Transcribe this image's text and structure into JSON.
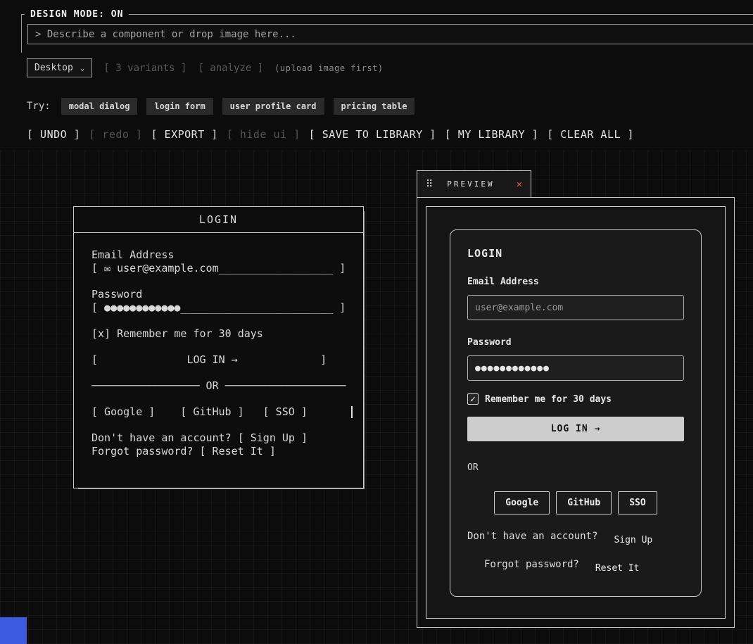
{
  "header": {
    "legend": "DESIGN MODE: ON",
    "prompt_placeholder": "> Describe a component or drop image here...",
    "device_select": "Desktop",
    "variants_button": "[ 3 variants ]",
    "analyze_button": "[ analyze ]",
    "upload_hint": "(upload image first)",
    "try_label": "Try:",
    "try_items": [
      "modal dialog",
      "login form",
      "user profile card",
      "pricing table"
    ],
    "toolbar": [
      {
        "label": "[ UNDO ]",
        "enabled": true
      },
      {
        "label": "[ redo ]",
        "enabled": false
      },
      {
        "label": "[ EXPORT ]",
        "enabled": true
      },
      {
        "label": "[ hide ui ]",
        "enabled": false
      },
      {
        "label": "[ SAVE TO LIBRARY ]",
        "enabled": true
      },
      {
        "label": "[ MY LIBRARY ]",
        "enabled": true
      },
      {
        "label": "[ CLEAR ALL ]",
        "enabled": true
      }
    ]
  },
  "ascii_panel": {
    "title": "LOGIN",
    "email_label": "Email Address",
    "email_field": "[ ✉ user@example.com__________________ ]",
    "password_label": "Password",
    "password_field": "[ ●●●●●●●●●●●●________________________ ]",
    "remember": "[x] Remember me for 30 days",
    "login_button": "[              LOG IN →             ]",
    "divider": "───────────────── OR ───────────────────",
    "google": "[ Google ]",
    "github": "[ GitHub ]",
    "sso": "[ SSO ]",
    "signup_text": "Don't have an account?",
    "signup_link": "[ Sign Up ]",
    "reset_text": "Forgot password?",
    "reset_link": "[ Reset It ]"
  },
  "preview": {
    "title": "PREVIEW",
    "card": {
      "title": "LOGIN",
      "email_label": "Email Address",
      "email_placeholder": "user@example.com",
      "password_label": "Password",
      "password_value": "●●●●●●●●●●●●",
      "remember_label": "Remember me for 30 days",
      "login_button": "LOG IN →",
      "divider": "OR",
      "social_buttons": [
        "Google",
        "GitHub",
        "SSO"
      ],
      "signup_text": "Don't have an account?",
      "signup_link": "Sign Up",
      "forgot_text": "Forgot password?",
      "forgot_link": "Reset It"
    }
  },
  "icons": {
    "chevron_down": "⌄",
    "drag_handle": "⠿",
    "close": "✕",
    "check": "✓"
  },
  "colors": {
    "background": "#0c0c0c",
    "accent_red": "#e2574c",
    "corner_blue": "#3d5be0",
    "login_button_bg": "#cdcdcd"
  }
}
